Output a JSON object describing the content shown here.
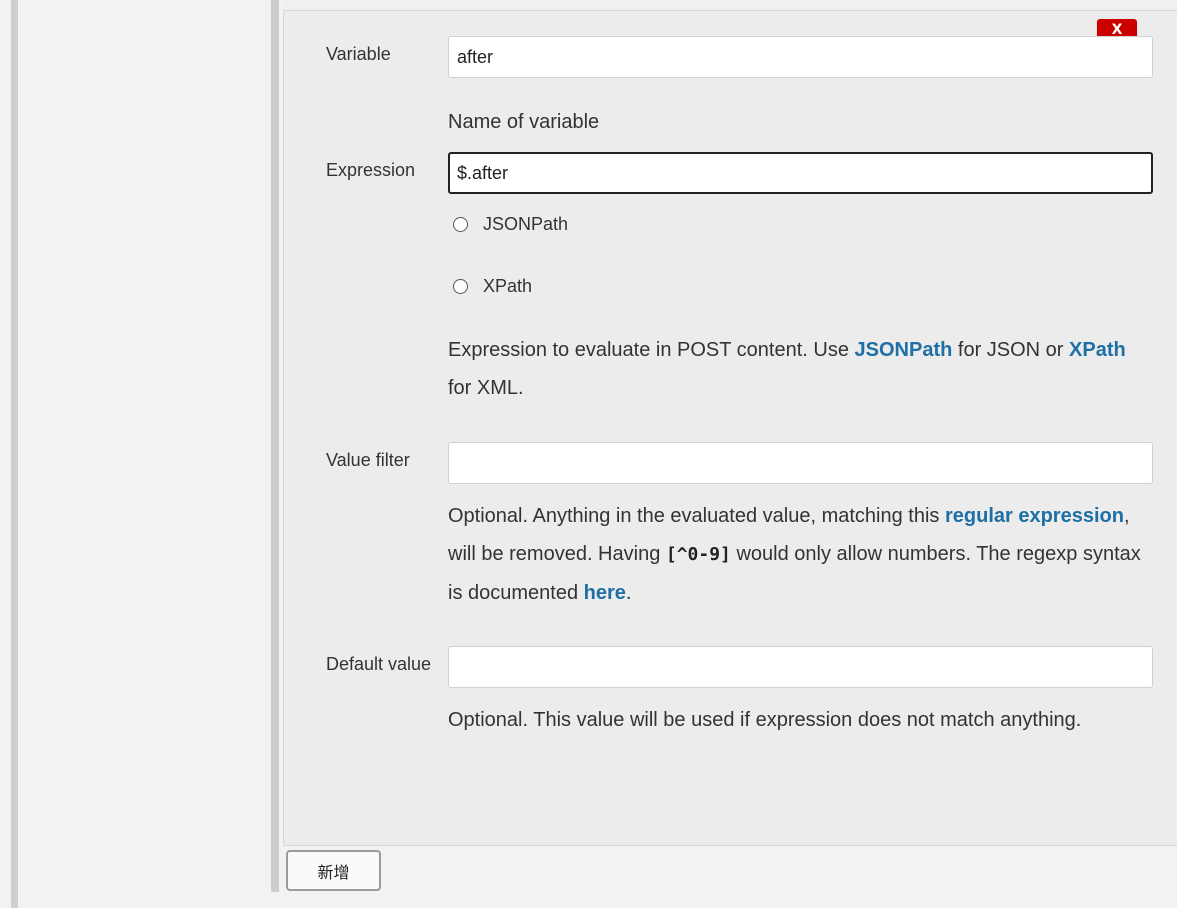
{
  "delete_button": {
    "label": "X",
    "color": "#cc0000"
  },
  "fields": {
    "variable": {
      "label": "Variable",
      "value": "after",
      "help": "Name of variable"
    },
    "expression": {
      "label": "Expression",
      "value": "$.after",
      "options": [
        "JSONPath",
        "XPath"
      ],
      "help": {
        "part1": "Expression to evaluate in POST content. Use ",
        "link1": "JSONPath",
        "part2": " for JSON or ",
        "link2": "XPath",
        "part3": " for XML."
      }
    },
    "value_filter": {
      "label": "Value filter",
      "value": "",
      "help": {
        "part1": "Optional. Anything in the evaluated value, matching this ",
        "link1": "regular expression",
        "part2": ", will be removed. Having ",
        "code": "[^0-9]",
        "part3": " would only allow numbers. The regexp syntax is documented ",
        "link2": "here",
        "part4": "."
      }
    },
    "default_value": {
      "label": "Default value",
      "value": "",
      "help": "Optional. This value will be used if expression does not match anything."
    }
  },
  "add_button": {
    "label": "新增"
  },
  "colors": {
    "link": "#1d6fa5",
    "panel": "#ececec",
    "background": "#f2f2f2"
  }
}
